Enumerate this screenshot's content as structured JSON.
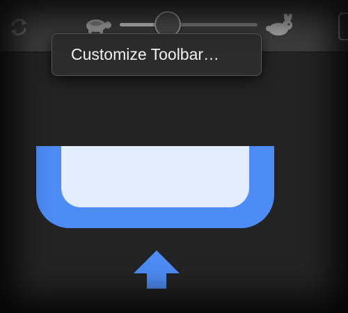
{
  "toolbar": {
    "refresh_icon": "refresh-icon",
    "slow_icon": "turtle-icon",
    "fast_icon": "rabbit-icon",
    "speed_slider": {
      "value": 0.35
    }
  },
  "context_menu": {
    "items": [
      {
        "label": "Customize Toolbar…"
      }
    ]
  },
  "colors": {
    "accent_blue": "#4d8cf5",
    "inner_fill": "#e3edfd",
    "background": "#232323",
    "toolbar": "#3b3b3b"
  }
}
